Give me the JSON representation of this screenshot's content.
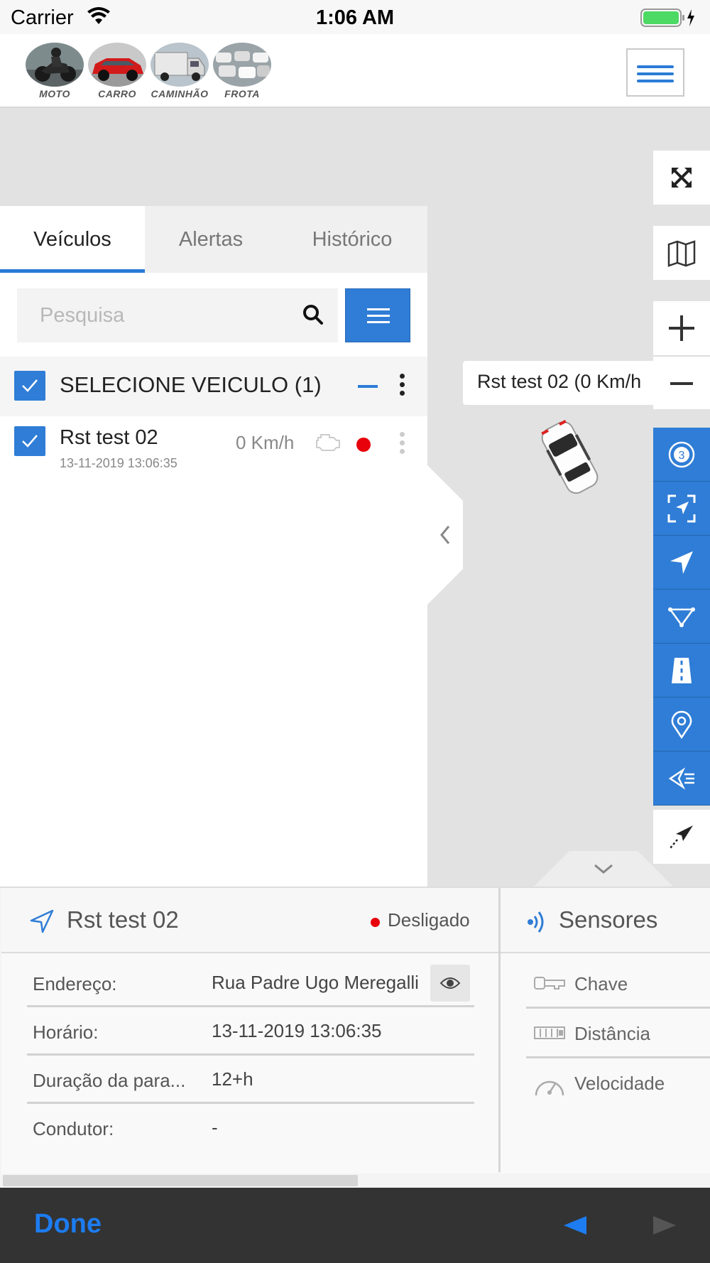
{
  "status_bar": {
    "carrier": "Carrier",
    "time": "1:06 AM"
  },
  "header": {
    "categories": [
      {
        "label": "MOTO"
      },
      {
        "label": "CARRO"
      },
      {
        "label": "CAMINHÃO"
      },
      {
        "label": "FROTA"
      }
    ]
  },
  "panel": {
    "tabs": [
      {
        "label": "Veículos",
        "active": true
      },
      {
        "label": "Alertas",
        "active": false
      },
      {
        "label": "Histórico",
        "active": false
      }
    ],
    "search": {
      "placeholder": "Pesquisa",
      "value": ""
    },
    "group": {
      "label": "SELECIONE VEICULO (1)",
      "checked": true
    },
    "vehicles": [
      {
        "name": "Rst test 02",
        "timestamp": "13-11-2019 13:06:35",
        "speed": "0 Km/h",
        "status_color": "#e8000b",
        "checked": true
      }
    ]
  },
  "map": {
    "marker_label": "Rst test 02 (0 Km/h",
    "toolbar_icons": [
      "fullscreen-icon",
      "map-layers-icon",
      "zoom-in-icon",
      "zoom-out-icon",
      "clustering-icon",
      "fit-bounds-icon",
      "navigate-icon",
      "polygon-icon",
      "road-icon",
      "pin-icon",
      "history-icon",
      "route-icon"
    ],
    "cluster_count": "3"
  },
  "details": {
    "title": "Rst test 02",
    "state": "Desligado",
    "rows": [
      {
        "key": "Endereço:",
        "value": "Rua Padre Ugo Meregalli"
      },
      {
        "key": "Horário:",
        "value": "13-11-2019 13:06:35"
      },
      {
        "key": "Duração da para...",
        "value": "12+h"
      },
      {
        "key": "Condutor:",
        "value": "-"
      }
    ]
  },
  "sensors": {
    "title": "Sensores",
    "items": [
      {
        "label": "Chave",
        "icon": "key-icon"
      },
      {
        "label": "Distância",
        "icon": "odometer-icon"
      },
      {
        "label": "Velocidade",
        "icon": "speedometer-icon"
      }
    ]
  },
  "accessory": {
    "done": "Done"
  },
  "colors": {
    "accent": "#2f7dd6",
    "danger": "#e8000b",
    "accessory_bg": "#333333",
    "done_blue": "#1d7cf0"
  }
}
